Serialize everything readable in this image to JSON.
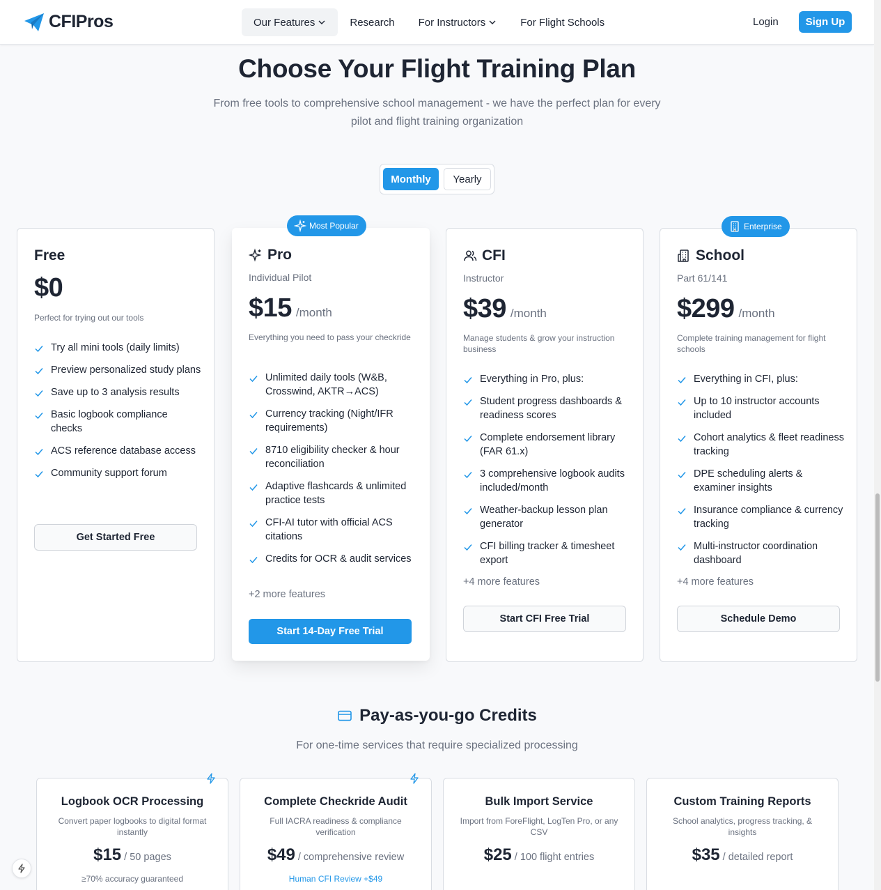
{
  "nav": {
    "brand": "CFIPros",
    "items": [
      {
        "label": "Our Features",
        "has_dropdown": true,
        "active": true
      },
      {
        "label": "Research",
        "has_dropdown": false
      },
      {
        "label": "For Instructors",
        "has_dropdown": true
      },
      {
        "label": "For Flight Schools",
        "has_dropdown": false
      }
    ],
    "login": "Login",
    "signup": "Sign Up"
  },
  "hero": {
    "title": "Choose Your Flight Training Plan",
    "subtitle": "From free tools to comprehensive school management - we have the perfect plan for every pilot and flight training organization"
  },
  "billing_toggle": {
    "monthly": "Monthly",
    "yearly": "Yearly",
    "selected": "Monthly"
  },
  "plans": [
    {
      "name": "Free",
      "role": "",
      "price": "$0",
      "per": "",
      "badge": "",
      "description": "Perfect for trying out our tools",
      "features": [
        "Try all mini tools (daily limits)",
        "Preview personalized study plans",
        "Save up to 3 analysis results",
        "Basic logbook compliance checks",
        "ACS reference database access",
        "Community support forum"
      ],
      "more": "",
      "cta": "Get Started Free"
    },
    {
      "name": "Pro",
      "role": "Individual Pilot",
      "price": "$15",
      "per": "/month",
      "badge": "Most Popular",
      "icon": "sparkles-icon",
      "description": "Everything you need to pass your checkride",
      "features": [
        "Unlimited daily tools (W&B, Crosswind, AKTR→ACS)",
        "Currency tracking (Night/IFR requirements)",
        "8710 eligibility checker & hour reconciliation",
        "Adaptive flashcards & unlimited practice tests",
        "CFI-AI tutor with official ACS citations",
        "Credits for OCR & audit services"
      ],
      "more": "+2 more features",
      "cta": "Start 14-Day Free Trial"
    },
    {
      "name": "CFI",
      "role": "Instructor",
      "price": "$39",
      "per": "/month",
      "badge": "",
      "icon": "users-icon",
      "description": "Manage students & grow your instruction business",
      "features": [
        "Everything in Pro, plus:",
        "Student progress dashboards & readiness scores",
        "Complete endorsement library (FAR 61.x)",
        "3 comprehensive logbook audits included/month",
        "Weather-backup lesson plan generator",
        "CFI billing tracker & timesheet export"
      ],
      "more": "+4 more features",
      "cta": "Start CFI Free Trial"
    },
    {
      "name": "School",
      "role": "Part 61/141",
      "price": "$299",
      "per": "/month",
      "badge": "Enterprise",
      "icon": "building-icon",
      "description": "Complete training management for flight schools",
      "features": [
        "Everything in CFI, plus:",
        "Up to 10 instructor accounts included",
        "Cohort analytics & fleet readiness tracking",
        "DPE scheduling alerts & examiner insights",
        "Insurance compliance & currency tracking",
        "Multi-instructor coordination dashboard"
      ],
      "more": "+4 more features",
      "cta": "Schedule Demo"
    }
  ],
  "credits": {
    "title": "Pay-as-you-go Credits",
    "subtitle": "For one-time services that require specialized processing",
    "items": [
      {
        "title": "Logbook OCR Processing",
        "description": "Convert paper logbooks to digital format instantly",
        "price": "$15",
        "unit": "/ 50 pages",
        "note": "≥70% accuracy guaranteed",
        "bolt": true
      },
      {
        "title": "Complete Checkride Audit",
        "description": "Full IACRA readiness & compliance verification",
        "price": "$49",
        "unit": "/ comprehensive review",
        "note": "Human CFI Review +$49",
        "bolt": true
      },
      {
        "title": "Bulk Import Service",
        "description": "Import from ForeFlight, LogTen Pro, or any CSV",
        "price": "$25",
        "unit": "/ 100 flight entries",
        "note": "",
        "bolt": false
      },
      {
        "title": "Custom Training Reports",
        "description": "School analytics, progress tracking, & insights",
        "price": "$35",
        "unit": "/ detailed report",
        "note": "",
        "bolt": false
      }
    ]
  },
  "colors": {
    "accent": "#2297e8",
    "text": "#1e2533",
    "muted": "#6b7280"
  }
}
